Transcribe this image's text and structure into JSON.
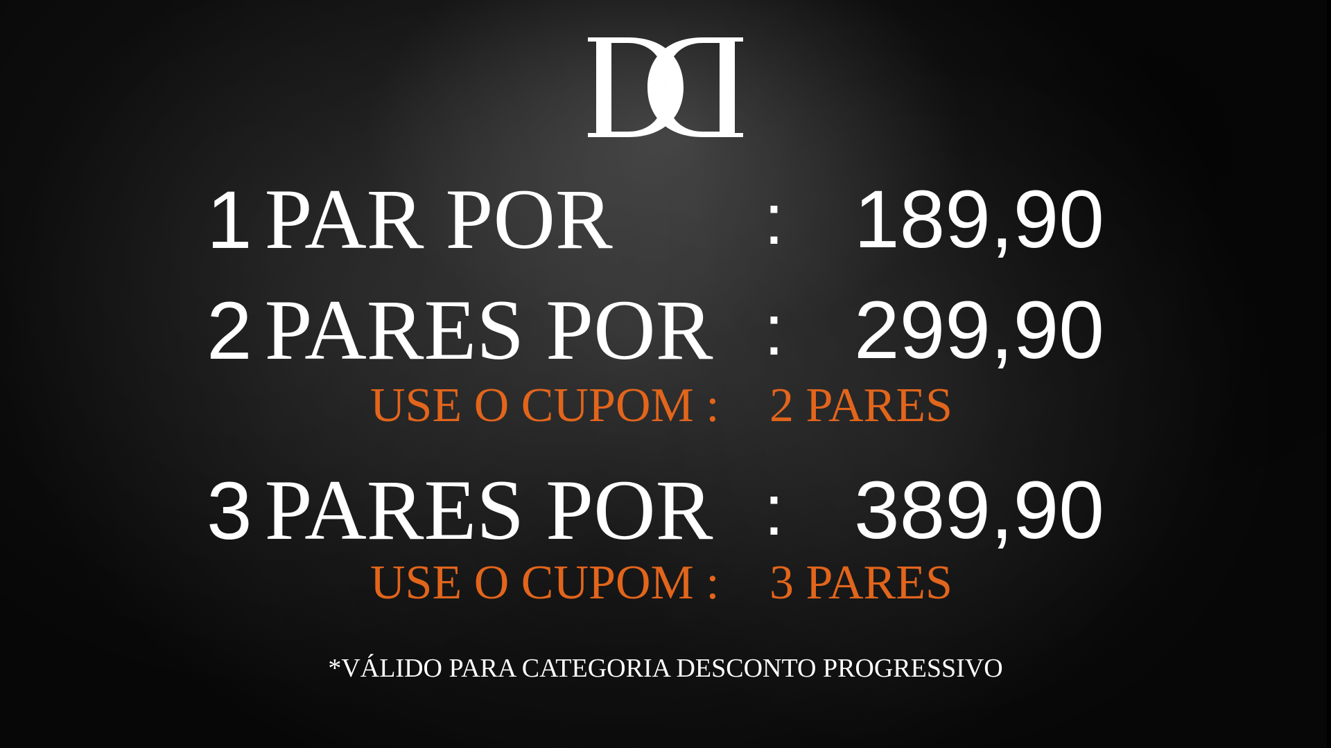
{
  "logo": {
    "name": "DD monogram",
    "color": "#ffffff"
  },
  "offers": [
    {
      "qty": "1",
      "label": "PAR POR",
      "colon": ":",
      "price": "189,90"
    },
    {
      "qty": "2",
      "label": "PARES POR",
      "colon": ":",
      "price": "299,90"
    },
    {
      "qty": "3",
      "label": "PARES POR",
      "colon": ":",
      "price": "389,90"
    }
  ],
  "coupons": [
    {
      "label": "USE O CUPOM :",
      "code": "2 PARES"
    },
    {
      "label": "USE O CUPOM :",
      "code": "3 PARES"
    }
  ],
  "footnote": "*VÁLIDO PARA CATEGORIA DESCONTO PROGRESSIVO",
  "colors": {
    "background": "#151515",
    "text": "#ffffff",
    "accent": "#e2651c"
  }
}
